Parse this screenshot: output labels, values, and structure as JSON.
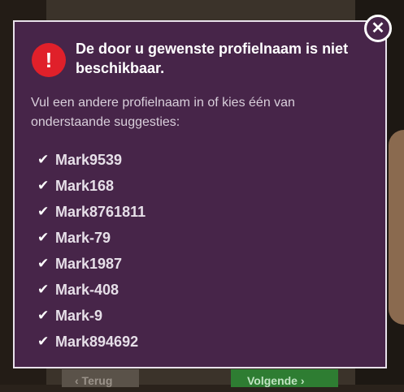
{
  "dialog": {
    "title": "De door u gewenste profielnaam is niet beschikbaar.",
    "description": "Vul een andere profielnaam in of kies één van onderstaande suggesties:",
    "close_glyph": "✕",
    "alert_glyph": "!",
    "suggestions": [
      "Mark9539",
      "Mark168",
      "Mark8761811",
      "Mark-79",
      "Mark1987",
      "Mark-408",
      "Mark-9",
      "Mark894692"
    ]
  },
  "background": {
    "back_button": "‹ Terug",
    "next_button": "Volgende ›"
  },
  "colors": {
    "modal_bg": "#472549",
    "alert": "#e0202a",
    "next_button": "#2e7d32"
  },
  "icons": {
    "close": "close-icon",
    "alert": "exclamation-icon",
    "check": "check-icon"
  }
}
